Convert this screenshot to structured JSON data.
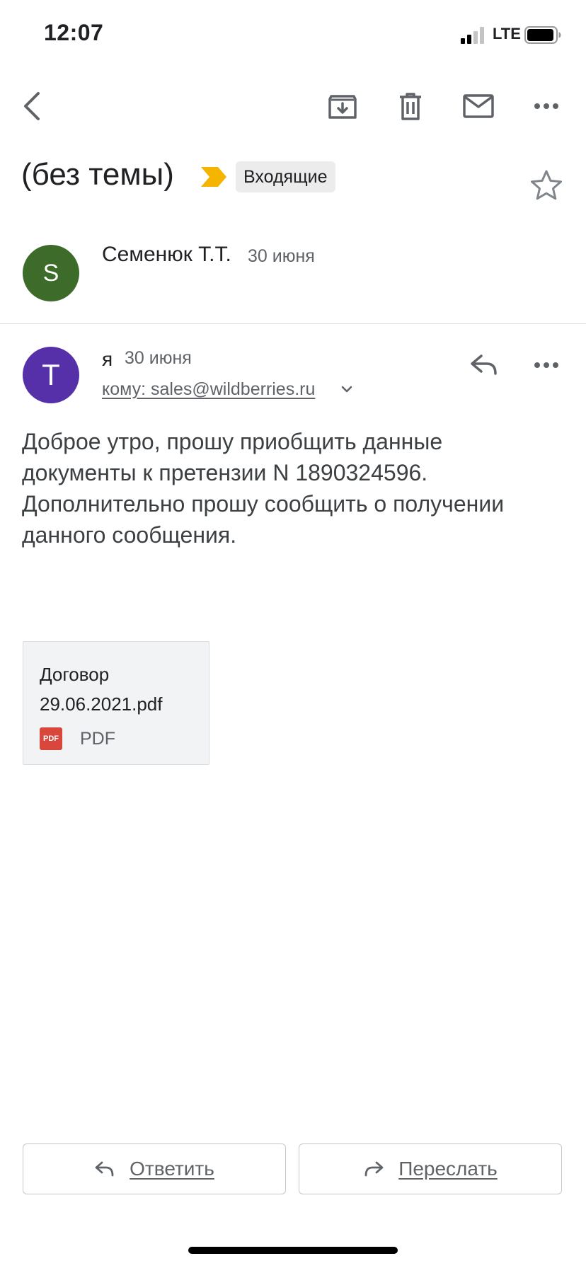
{
  "status_bar": {
    "time": "12:07",
    "network": "LTE"
  },
  "toolbar": {
    "icons": [
      "back-icon",
      "archive-icon",
      "trash-icon",
      "mail-icon",
      "more-icon"
    ]
  },
  "thread": {
    "subject": "(без темы)",
    "label": "Входящие",
    "important_color": "#f4b400"
  },
  "messages": [
    {
      "avatar_letter": "S",
      "avatar_color": "#3d6b2a",
      "sender": "Семенюк Т.Т.",
      "date": "30 июня"
    },
    {
      "avatar_letter": "T",
      "avatar_color": "#5530a8",
      "sender": "я",
      "date": "30 июня",
      "to": "кому: sales@wildberries.ru",
      "body": [
        "Доброе утро, прошу приобщить данные",
        "документы к претензии N 1890324596.",
        "Дополнительно прошу сообщить о получении",
        "данного сообщения."
      ],
      "attachment": {
        "name_line1": "Договор",
        "name_line2": "29.06.2021.pdf",
        "icon_text": "PDF",
        "type": "PDF"
      }
    }
  ],
  "actions": {
    "reply_label": "Ответить",
    "forward_label": "Переслать"
  }
}
